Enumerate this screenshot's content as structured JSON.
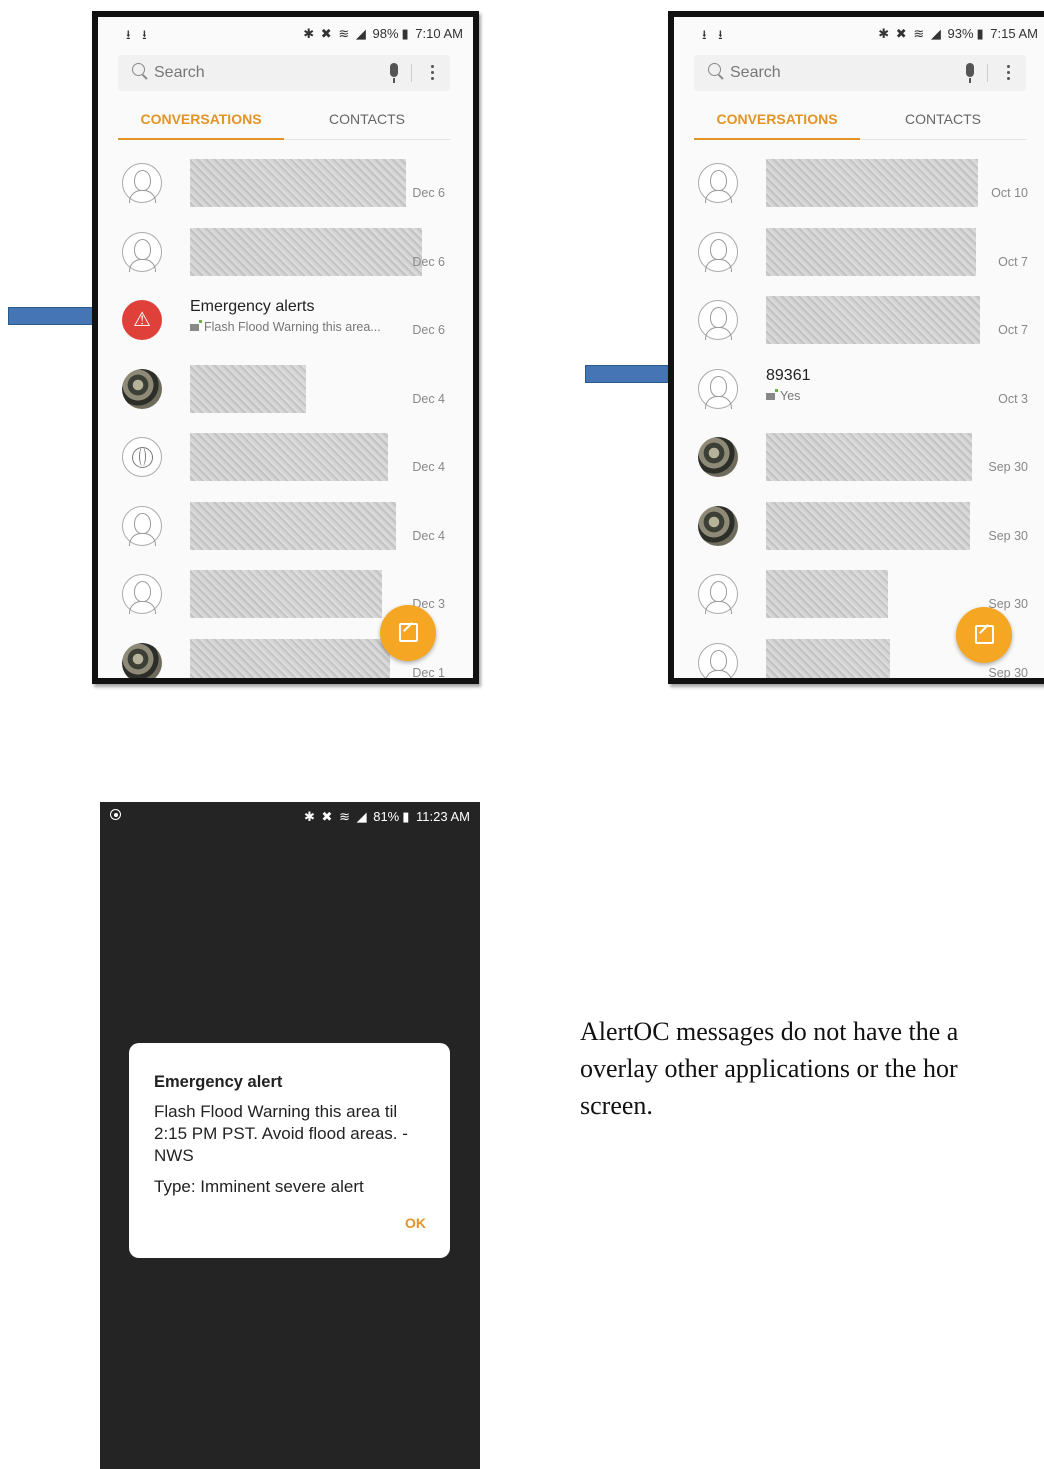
{
  "phone1": {
    "status": {
      "left": "⭳ ⭳",
      "bt": "✱",
      "mute": "✖",
      "wifi": "≋",
      "signal": "◢",
      "battery_pct": "98%",
      "battery_icon": "▮",
      "time": "7:10 AM"
    },
    "search": {
      "placeholder": "Search"
    },
    "tabs": {
      "conversations": "CONVERSATIONS",
      "contacts": "CONTACTS"
    },
    "rows": [
      {
        "avatar": "person-icon",
        "title": "",
        "snippet": "",
        "date": "Dec 6",
        "redacted": true
      },
      {
        "avatar": "person-icon",
        "title": "",
        "snippet": "",
        "date": "Dec 6",
        "redacted": true
      },
      {
        "avatar": "alert-icon",
        "title": "Emergency alerts",
        "snippet": "Flash Flood Warning this area...",
        "date": "Dec 6",
        "redacted": false
      },
      {
        "avatar": "photo",
        "title": "",
        "snippet": "",
        "date": "Dec 4",
        "redacted": true
      },
      {
        "avatar": "globe-icon",
        "title": "",
        "snippet": "",
        "date": "Dec 4",
        "redacted": true
      },
      {
        "avatar": "person-icon",
        "title": "",
        "snippet": "",
        "date": "Dec 4",
        "redacted": true
      },
      {
        "avatar": "person-icon",
        "title": "",
        "snippet": "",
        "date": "Dec 3",
        "redacted": true
      },
      {
        "avatar": "photo",
        "title": "",
        "snippet": "",
        "date": "Dec 1",
        "redacted": true
      }
    ]
  },
  "phone2": {
    "status": {
      "left": "⭳ ⭳",
      "bt": "✱",
      "mute": "✖",
      "wifi": "≋",
      "signal": "◢",
      "battery_pct": "93%",
      "battery_icon": "▮",
      "time": "7:15 AM"
    },
    "search": {
      "placeholder": "Search"
    },
    "tabs": {
      "conversations": "CONVERSATIONS",
      "contacts": "CONTACTS"
    },
    "rows": [
      {
        "avatar": "person-icon",
        "title": "",
        "snippet": "",
        "date": "Oct 10",
        "redacted": true
      },
      {
        "avatar": "person-icon",
        "title": "",
        "snippet": "",
        "date": "Oct 7",
        "redacted": true
      },
      {
        "avatar": "person-icon",
        "title": "",
        "snippet": "",
        "date": "Oct 7",
        "redacted": true
      },
      {
        "avatar": "person-icon",
        "title": "89361",
        "snippet": "Yes",
        "date": "Oct 3",
        "redacted": false
      },
      {
        "avatar": "photo",
        "title": "",
        "snippet": "",
        "date": "Sep 30",
        "redacted": true
      },
      {
        "avatar": "photo",
        "title": "",
        "snippet": "",
        "date": "Sep 30",
        "redacted": true
      },
      {
        "avatar": "person-icon",
        "title": "",
        "snippet": "",
        "date": "Sep 30",
        "redacted": true
      },
      {
        "avatar": "person-icon",
        "title": "",
        "snippet": "",
        "date": "Sep 30",
        "redacted": true
      }
    ]
  },
  "phone3": {
    "status": {
      "rec": "◉",
      "bt": "✱",
      "mute": "✖",
      "wifi": "≋",
      "signal": "◢",
      "battery_pct": "81%",
      "battery_icon": "▮",
      "time": "11:23 AM"
    },
    "dialog": {
      "title": "Emergency alert",
      "body": "Flash Flood Warning this area til 2:15 PM PST. Avoid flood areas. -NWS",
      "type": "Type: Imminent severe alert",
      "ok": "OK"
    }
  },
  "caption": {
    "line1": "AlertOC messages do not have the a",
    "line2": "overlay other applications or the hor",
    "line3": "screen."
  },
  "colors": {
    "accent": "#e39425",
    "alert_red": "#e0403a",
    "fab": "#f5a623",
    "arrow": "#4575b4"
  }
}
